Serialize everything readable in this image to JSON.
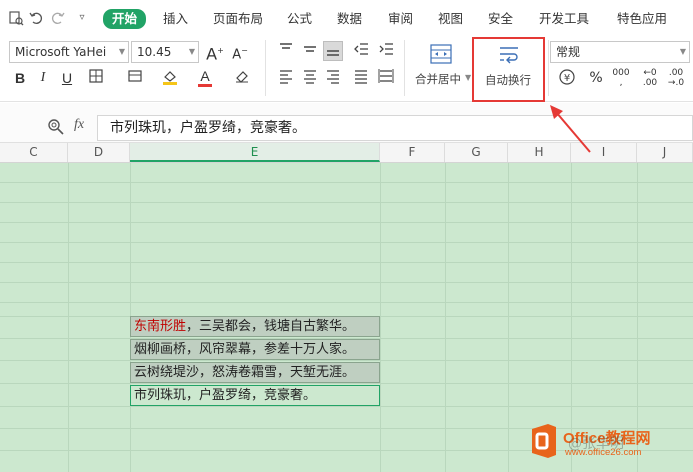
{
  "menubar": {
    "tabs": [
      "开始",
      "插入",
      "页面布局",
      "公式",
      "数据",
      "审阅",
      "视图",
      "安全",
      "开发工具",
      "特色应用"
    ],
    "active_tab": "开始"
  },
  "ribbon": {
    "font_name": "Microsoft YaHei",
    "font_size": "10.45",
    "merge_label": "合并居中",
    "wrap_label": "自动换行",
    "number_format": "常规",
    "highlight_color": "#e53935"
  },
  "formula_bar": {
    "fx_label": "fx",
    "content": "市列珠玑，户盈罗绮，竞豪奢。"
  },
  "columns": [
    "C",
    "D",
    "E",
    "F",
    "G",
    "H",
    "I",
    "J"
  ],
  "selected_column": "E",
  "cells": [
    {
      "red": "东南形胜",
      "text": "，三吴都会，钱塘自古繁华。"
    },
    {
      "red": "",
      "text": "烟柳画桥，风帘翠幕，参差十万人家。"
    },
    {
      "red": "",
      "text": "云树绕堤沙，怒涛卷霜雪，天堑无涯。"
    },
    {
      "red": "",
      "text": "市列珠玑，户盈罗绮，竞豪奢。"
    }
  ],
  "watermark": {
    "brand": "Office教程网",
    "url": "www.office26.com",
    "overlay": "@张华明"
  }
}
